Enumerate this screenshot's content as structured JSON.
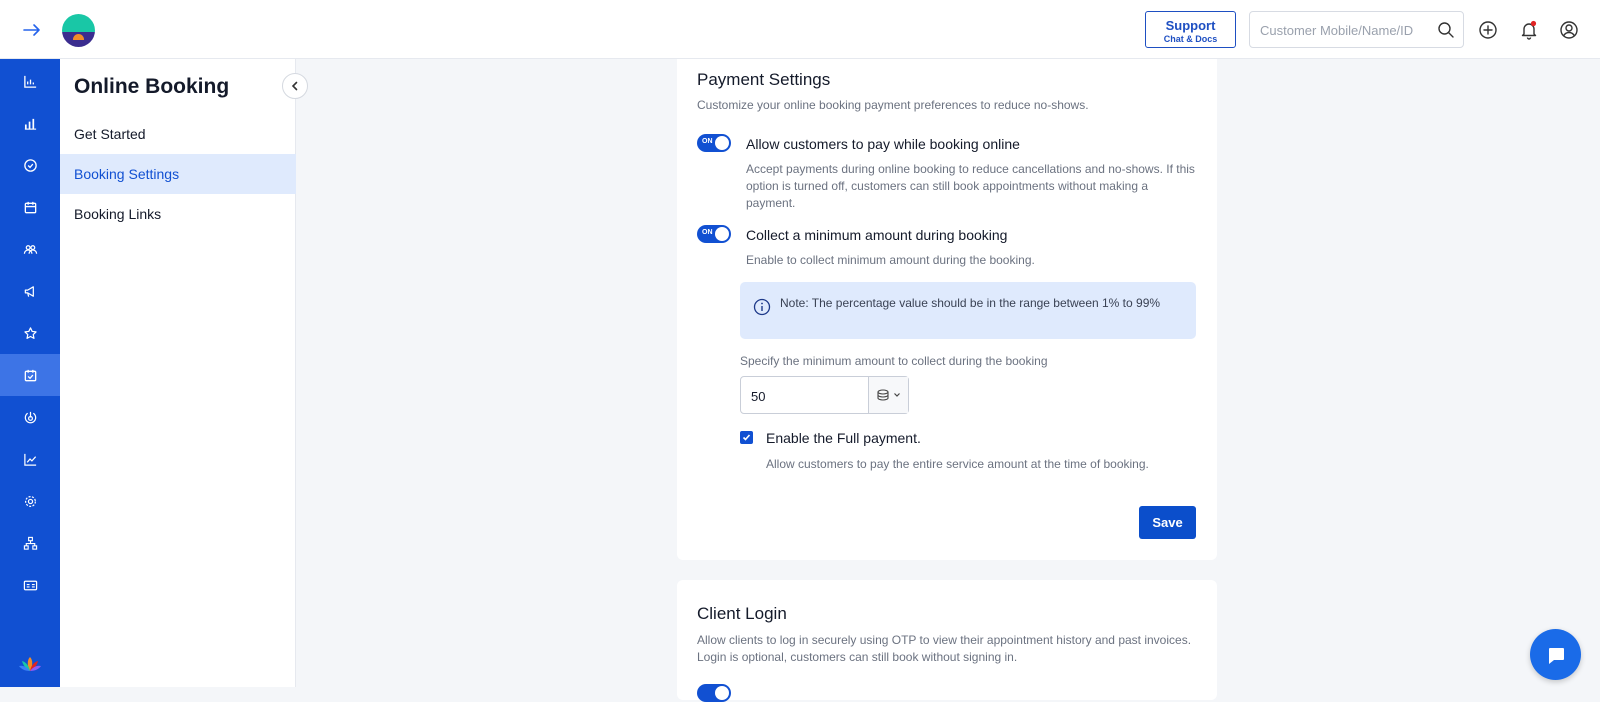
{
  "topbar": {
    "support_label": "Support",
    "support_sub": "Chat & Docs",
    "search_placeholder": "Customer Mobile/Name/ID"
  },
  "leftnav": {
    "items": [
      {
        "icon": "dashboard-chart-icon"
      },
      {
        "icon": "bar-chart-icon"
      },
      {
        "icon": "check-circle-icon"
      },
      {
        "icon": "calendar-icon"
      },
      {
        "icon": "customers-icon"
      },
      {
        "icon": "megaphone-icon"
      },
      {
        "icon": "star-icon"
      },
      {
        "icon": "online-booking-icon",
        "active": true
      },
      {
        "icon": "hand-icon"
      },
      {
        "icon": "trend-chart-icon"
      },
      {
        "icon": "settings-icon"
      },
      {
        "icon": "hierarchy-icon"
      },
      {
        "icon": "id-card-icon"
      }
    ]
  },
  "submenu": {
    "title": "Online Booking",
    "items": [
      {
        "label": "Get Started",
        "active": false
      },
      {
        "label": "Booking Settings",
        "active": true
      },
      {
        "label": "Booking Links",
        "active": false
      }
    ]
  },
  "payment": {
    "title": "Payment Settings",
    "subtitle": "Customize your online booking payment preferences to reduce no-shows.",
    "opt1_title": "Allow customers to pay while booking online",
    "opt1_desc": "Accept payments during online booking to reduce cancellations and no-shows. If this option is turned off, customers can still book appointments without making a payment.",
    "opt2_title": "Collect a minimum amount during booking",
    "opt2_desc": "Enable to collect minimum amount during the booking.",
    "toggle_on_label": "ON",
    "note": "Note: The percentage value should be in the range between 1% to 99%",
    "amount_label": "Specify the minimum amount to collect during the booking",
    "amount_value": "50",
    "full_payment_title": "Enable the Full payment.",
    "full_payment_desc": "Allow customers to pay the entire service amount at the time of booking.",
    "full_payment_checked": true,
    "save_label": "Save"
  },
  "client_login": {
    "title": "Client Login",
    "desc": "Allow clients to log in securely using OTP to view their appointment history and past invoices. Login is optional, customers can still book without signing in."
  },
  "colors": {
    "primary": "#1150d2",
    "nav_active": "#3d74e6",
    "submenu_active_bg": "#dfeafd",
    "note_bg": "#dfeafd"
  }
}
